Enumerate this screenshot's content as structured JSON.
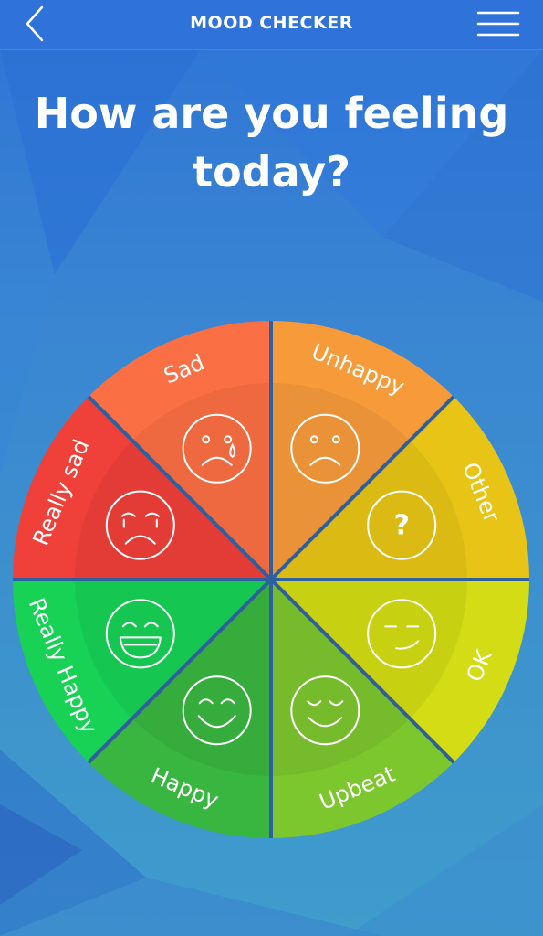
{
  "header": {
    "title": "MOOD CHECKER"
  },
  "prompt": {
    "line1": "How are you feeling",
    "line2": "today?"
  },
  "moods": [
    {
      "label": "Unhappy",
      "icon": "unhappy-face-icon",
      "color": "#f79a3a"
    },
    {
      "label": "Other",
      "icon": "question-mark-icon",
      "color": "#e8c416"
    },
    {
      "label": "OK",
      "icon": "neutral-face-icon",
      "color": "#d3dc14"
    },
    {
      "label": "Upbeat",
      "icon": "content-face-icon",
      "color": "#7cc62e"
    },
    {
      "label": "Happy",
      "icon": "smiling-face-icon",
      "color": "#38b640"
    },
    {
      "label": "Really Happy",
      "icon": "grinning-face-icon",
      "color": "#17d255"
    },
    {
      "label": "Really sad",
      "icon": "crying-face-icon",
      "color": "#f0403a"
    },
    {
      "label": "Sad",
      "icon": "sad-tear-face-icon",
      "color": "#fb6f44"
    }
  ],
  "icons": {
    "other_glyph": "?"
  },
  "colors": {
    "nav_bar": "#2f72da",
    "divider": "#2e5f9e",
    "text": "#ffffff"
  }
}
